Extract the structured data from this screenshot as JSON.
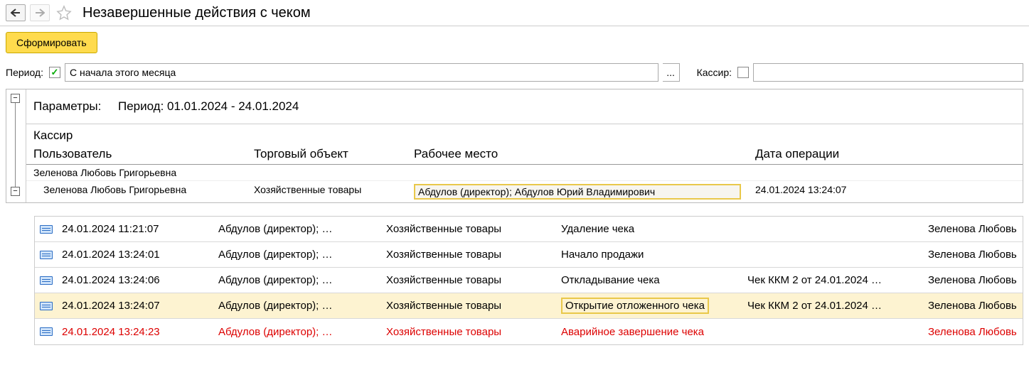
{
  "header": {
    "title": "Незавершенные действия с чеком"
  },
  "actions": {
    "generate": "Сформировать"
  },
  "filters": {
    "period_label": "Период:",
    "period_value": "С начала этого месяца",
    "ellipsis": "...",
    "cashier_label": "Кассир:"
  },
  "report": {
    "params_label": "Параметры:",
    "params_value": "Период: 01.01.2024 - 24.01.2024",
    "cashier_header": "Кассир",
    "cols": {
      "user": "Пользователь",
      "obj": "Торговый объект",
      "wp": "Рабочее место",
      "date": "Дата операции"
    },
    "group_user": "Зеленова Любовь Григорьевна",
    "row": {
      "user": "Зеленова Любовь Григорьевна",
      "obj": "Хозяйственные товары",
      "wp": "Абдулов (директор); Абдулов Юрий Владимирович",
      "date": "24.01.2024 13:24:07"
    }
  },
  "events": [
    {
      "ts": "24.01.2024 11:21:07",
      "wp": "Абдулов (директор); …",
      "obj": "Хозяйственные товары",
      "action": "Удаление чека",
      "doc": "",
      "user": "Зеленова Любовь",
      "sel": false,
      "err": false,
      "hl": false
    },
    {
      "ts": "24.01.2024 13:24:01",
      "wp": "Абдулов (директор); …",
      "obj": "Хозяйственные товары",
      "action": "Начало продажи",
      "doc": "",
      "user": "Зеленова Любовь",
      "sel": false,
      "err": false,
      "hl": false
    },
    {
      "ts": "24.01.2024 13:24:06",
      "wp": "Абдулов (директор); …",
      "obj": "Хозяйственные товары",
      "action": "Откладывание чека",
      "doc": "Чек ККМ 2 от 24.01.2024 …",
      "user": "Зеленова Любовь",
      "sel": false,
      "err": false,
      "hl": false
    },
    {
      "ts": "24.01.2024 13:24:07",
      "wp": "Абдулов (директор); …",
      "obj": "Хозяйственные товары",
      "action": "Открытие отложенного чека",
      "doc": "Чек ККМ 2 от 24.01.2024 …",
      "user": "Зеленова Любовь",
      "sel": true,
      "err": false,
      "hl": true
    },
    {
      "ts": "24.01.2024 13:24:23",
      "wp": "Абдулов (директор); …",
      "obj": "Хозяйственные товары",
      "action": "Аварийное завершение чека",
      "doc": "",
      "user": "Зеленова Любовь",
      "sel": false,
      "err": true,
      "hl": false
    }
  ]
}
